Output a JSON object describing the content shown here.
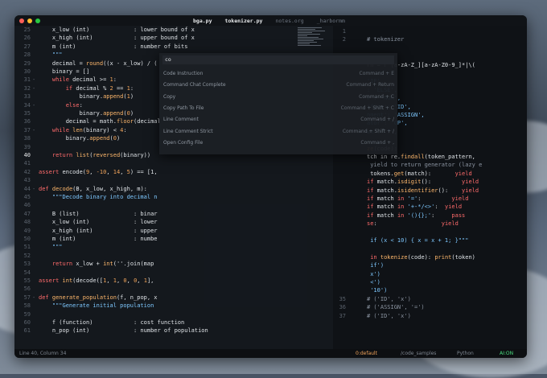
{
  "window": {
    "tabs": [
      {
        "label": "bga.py",
        "active": true
      },
      {
        "label": "tokenizer.py",
        "active": true
      },
      {
        "label": "notes.org",
        "active": false
      },
      {
        "label": "_harbormm",
        "active": false
      }
    ]
  },
  "editor": {
    "lines": [
      {
        "n": "25",
        "code": [
          [
            "p",
            "    x_low (int)"
          ],
          [
            "p",
            "             : lower bound of x"
          ]
        ]
      },
      {
        "n": "26",
        "code": [
          [
            "p",
            "    x_high (int)"
          ],
          [
            "p",
            "            : upper bound of x"
          ]
        ]
      },
      {
        "n": "27",
        "code": [
          [
            "p",
            "    m (int)"
          ],
          [
            "p",
            "                 : number of bits"
          ]
        ]
      },
      {
        "n": "28",
        "code": [
          [
            "s",
            "    \"\"\""
          ]
        ]
      },
      {
        "n": "29",
        "code": [
          [
            "p",
            "    decimal = "
          ],
          [
            "f",
            "round"
          ],
          [
            "p",
            "((x - x_low) / ("
          ]
        ]
      },
      {
        "n": "30",
        "code": [
          [
            "p",
            "    binary = []"
          ]
        ]
      },
      {
        "n": "31",
        "fold": "-",
        "code": [
          [
            "k",
            "    while"
          ],
          [
            "p",
            " decimal >= "
          ],
          [
            "n",
            "1"
          ],
          [
            "p",
            ":"
          ]
        ]
      },
      {
        "n": "32",
        "fold": "-",
        "code": [
          [
            "k",
            "        if"
          ],
          [
            "p",
            " decimal % "
          ],
          [
            "n",
            "2"
          ],
          [
            "p",
            " == "
          ],
          [
            "n",
            "1"
          ],
          [
            "p",
            ":"
          ]
        ]
      },
      {
        "n": "33",
        "code": [
          [
            "p",
            "            binary."
          ],
          [
            "f",
            "append"
          ],
          [
            "p",
            "("
          ],
          [
            "n",
            "1"
          ],
          [
            "p",
            ")"
          ]
        ]
      },
      {
        "n": "34",
        "fold": "-",
        "code": [
          [
            "k",
            "        else"
          ],
          [
            "p",
            ":"
          ]
        ]
      },
      {
        "n": "35",
        "code": [
          [
            "p",
            "            binary."
          ],
          [
            "f",
            "append"
          ],
          [
            "p",
            "("
          ],
          [
            "n",
            "0"
          ],
          [
            "p",
            ")"
          ]
        ]
      },
      {
        "n": "36",
        "code": [
          [
            "p",
            "        decimal = math."
          ],
          [
            "f",
            "floor"
          ],
          [
            "p",
            "(decimal"
          ]
        ]
      },
      {
        "n": "37",
        "fold": "-",
        "code": [
          [
            "k",
            "    while"
          ],
          [
            "f",
            " len"
          ],
          [
            "p",
            "(binary) < "
          ],
          [
            "n",
            "4"
          ],
          [
            "p",
            ":"
          ]
        ]
      },
      {
        "n": "38",
        "code": [
          [
            "p",
            "        binary."
          ],
          [
            "f",
            "append"
          ],
          [
            "p",
            "("
          ],
          [
            "n",
            "0"
          ],
          [
            "p",
            ")"
          ]
        ]
      },
      {
        "n": "39",
        "code": [
          [
            "p",
            ""
          ]
        ]
      },
      {
        "n": "40",
        "cur": true,
        "code": [
          [
            "k",
            "    return"
          ],
          [
            "f",
            " list"
          ],
          [
            "p",
            "("
          ],
          [
            "f",
            "reversed"
          ],
          [
            "p",
            "(binary))"
          ]
        ]
      },
      {
        "n": "41",
        "code": [
          [
            "p",
            ""
          ]
        ]
      },
      {
        "n": "42",
        "code": [
          [
            "k",
            "assert"
          ],
          [
            "p",
            " encode("
          ],
          [
            "n",
            "9"
          ],
          [
            "p",
            ", "
          ],
          [
            "n",
            "-10"
          ],
          [
            "p",
            ", "
          ],
          [
            "n",
            "14"
          ],
          [
            "p",
            ", "
          ],
          [
            "n",
            "5"
          ],
          [
            "p",
            ") == [1,"
          ]
        ]
      },
      {
        "n": "43",
        "code": [
          [
            "p",
            ""
          ]
        ]
      },
      {
        "n": "44",
        "fold": "-",
        "code": [
          [
            "k",
            "def"
          ],
          [
            "f",
            " decode"
          ],
          [
            "p",
            "(B, x_low, x_high, m):"
          ]
        ]
      },
      {
        "n": "45",
        "code": [
          [
            "s",
            "    \"\"\"Decode binary into decimal n"
          ]
        ]
      },
      {
        "n": "46",
        "code": [
          [
            "p",
            ""
          ]
        ]
      },
      {
        "n": "47",
        "code": [
          [
            "p",
            "    B (list)"
          ],
          [
            "p",
            "                : binar"
          ]
        ]
      },
      {
        "n": "48",
        "code": [
          [
            "p",
            "    x_low (int)"
          ],
          [
            "p",
            "             : lower"
          ]
        ]
      },
      {
        "n": "49",
        "code": [
          [
            "p",
            "    x_high (int)"
          ],
          [
            "p",
            "            : upper"
          ]
        ]
      },
      {
        "n": "50",
        "code": [
          [
            "p",
            "    m (int)"
          ],
          [
            "p",
            "                 : numbe"
          ]
        ]
      },
      {
        "n": "51",
        "code": [
          [
            "s",
            "    \"\"\""
          ]
        ]
      },
      {
        "n": "52",
        "code": [
          [
            "p",
            ""
          ]
        ]
      },
      {
        "n": "53",
        "code": [
          [
            "k",
            "    return"
          ],
          [
            "p",
            " x_low + "
          ],
          [
            "f",
            "int"
          ],
          [
            "p",
            "(''.join(map"
          ]
        ]
      },
      {
        "n": "54",
        "code": [
          [
            "p",
            ""
          ]
        ]
      },
      {
        "n": "55",
        "code": [
          [
            "k",
            "assert"
          ],
          [
            "f",
            " int"
          ],
          [
            "p",
            "(decode(["
          ],
          [
            "n",
            "1"
          ],
          [
            "p",
            ", "
          ],
          [
            "n",
            "1"
          ],
          [
            "p",
            ", "
          ],
          [
            "n",
            "0"
          ],
          [
            "p",
            ", "
          ],
          [
            "n",
            "0"
          ],
          [
            "p",
            ", "
          ],
          [
            "n",
            "1"
          ],
          [
            "p",
            "],"
          ]
        ]
      },
      {
        "n": "56",
        "code": [
          [
            "p",
            ""
          ]
        ]
      },
      {
        "n": "57",
        "fold": "-",
        "code": [
          [
            "k",
            "def"
          ],
          [
            "f",
            " generate_population"
          ],
          [
            "p",
            "(f, n_pop, x"
          ]
        ]
      },
      {
        "n": "58",
        "code": [
          [
            "s",
            "    \"\"\"Generate initial population"
          ]
        ]
      },
      {
        "n": "59",
        "code": [
          [
            "p",
            ""
          ]
        ]
      },
      {
        "n": "60",
        "code": [
          [
            "p",
            "    f (function)"
          ],
          [
            "p",
            "            : cost function"
          ]
        ]
      },
      {
        "n": "61",
        "code": [
          [
            "p",
            "    n_pop (int)"
          ],
          [
            "p",
            "             : number of population"
          ]
        ]
      }
    ]
  },
  "right_pane": {
    "lines": [
      {
        "n": "1",
        "code": [
          [
            "p",
            ""
          ]
        ]
      },
      {
        "n": "2",
        "code": [
          [
            "c",
            "# tokenizer"
          ]
        ]
      },
      {
        "n": "",
        "code": [
          [
            "p",
            ""
          ]
        ]
      },
      {
        "n": "",
        "code": [
          [
            "p",
            ""
          ]
        ]
      },
      {
        "n": "",
        "code": [
          [
            "p",
            "rn = r'[a-zA-Z_][a-zA-Z0-9_]*|\\("
          ]
        ]
      },
      {
        "n": "",
        "code": [
          [
            "p",
            ""
          ]
        ]
      },
      {
        "n": "",
        "code": [
          [
            "s",
            "'IF',"
          ]
        ]
      },
      {
        "n": "",
        "code": [
          [
            "s",
            ": 'ELSE',"
          ]
        ]
      },
      {
        "n": "",
        "code": [
          [
            "s",
            "r': 'NUM',"
          ]
        ]
      },
      {
        "n": "",
        "code": [
          [
            "s",
            "ifier': 'ID',"
          ]
        ]
      },
      {
        "n": "",
        "code": [
          [
            "s",
            "nment': 'ASSIGN',"
          ]
        ]
      },
      {
        "n": "",
        "code": [
          [
            "s",
            "ator': 'OP',"
          ]
        ]
      },
      {
        "n": "",
        "code": [
          [
            "s",
            "wn': '?',"
          ]
        ]
      },
      {
        "n": "",
        "code": [
          [
            "p",
            ""
          ]
        ]
      },
      {
        "n": "",
        "code": [
          [
            "f",
            "ze"
          ],
          [
            "p",
            "(code):"
          ]
        ]
      },
      {
        "n": "",
        "code": [
          [
            "p",
            "tch in re."
          ],
          [
            "f",
            "findall"
          ],
          [
            "p",
            "(token_pattern,"
          ]
        ]
      },
      {
        "n": "",
        "code": [
          [
            "c",
            " yield to return generator (lazy e"
          ]
        ]
      },
      {
        "n": "",
        "code": [
          [
            "p",
            " tokens."
          ],
          [
            "f",
            "get"
          ],
          [
            "p",
            "(match):"
          ],
          [
            "k",
            "       yield"
          ]
        ]
      },
      {
        "n": "",
        "code": [
          [
            "k",
            "if"
          ],
          [
            "p",
            " match."
          ],
          [
            "f",
            "isdigit"
          ],
          [
            "p",
            "():"
          ],
          [
            "k",
            "         yield"
          ]
        ]
      },
      {
        "n": "",
        "code": [
          [
            "k",
            "if"
          ],
          [
            "p",
            " match."
          ],
          [
            "f",
            "isidentifier"
          ],
          [
            "p",
            "():"
          ],
          [
            "k",
            "    yield"
          ]
        ]
      },
      {
        "n": "",
        "code": [
          [
            "k",
            "if"
          ],
          [
            "p",
            " match "
          ],
          [
            "k",
            "in"
          ],
          [
            "s",
            " '='"
          ],
          [
            "p",
            ":"
          ],
          [
            "k",
            "         yield"
          ]
        ]
      },
      {
        "n": "",
        "code": [
          [
            "k",
            "if"
          ],
          [
            "p",
            " match "
          ],
          [
            "k",
            "in"
          ],
          [
            "s",
            " '+-*/<>'"
          ],
          [
            "p",
            ":"
          ],
          [
            "k",
            "  yield"
          ]
        ]
      },
      {
        "n": "",
        "code": [
          [
            "k",
            "if"
          ],
          [
            "p",
            " match "
          ],
          [
            "k",
            "in"
          ],
          [
            "s",
            " '(){};'"
          ],
          [
            "p",
            ":"
          ],
          [
            "k",
            "     pass"
          ]
        ]
      },
      {
        "n": "",
        "code": [
          [
            "k",
            "se"
          ],
          [
            "p",
            ":"
          ],
          [
            "k",
            "                   yield"
          ]
        ]
      },
      {
        "n": "",
        "code": [
          [
            "p",
            ""
          ]
        ]
      },
      {
        "n": "",
        "code": [
          [
            "s",
            " if (x < 10) { x = x + 1; }\"\"\""
          ]
        ]
      },
      {
        "n": "",
        "code": [
          [
            "p",
            ""
          ]
        ]
      },
      {
        "n": "",
        "code": [
          [
            "k",
            " in"
          ],
          [
            "f",
            " tokenize"
          ],
          [
            "p",
            "(code): "
          ],
          [
            "f",
            "print"
          ],
          [
            "p",
            "(token)"
          ]
        ]
      },
      {
        "n": "",
        "code": [
          [
            "s",
            " if')"
          ]
        ]
      },
      {
        "n": "",
        "code": [
          [
            "s",
            " x')"
          ]
        ]
      },
      {
        "n": "",
        "code": [
          [
            "s",
            " <')"
          ]
        ]
      },
      {
        "n": "",
        "code": [
          [
            "s",
            " '10')"
          ]
        ]
      },
      {
        "n": "35",
        "code": [
          [
            "c",
            "# ('ID', 'x')"
          ]
        ]
      },
      {
        "n": "36",
        "code": [
          [
            "c",
            "# ('ASSIGN', '=')"
          ]
        ]
      },
      {
        "n": "37",
        "code": [
          [
            "c",
            "# ('ID', 'x')"
          ]
        ]
      }
    ]
  },
  "palette": {
    "query": "co",
    "items": [
      {
        "label": "Code Instruction",
        "shortcut": "Command + E"
      },
      {
        "label": "Command Chat Complete",
        "shortcut": "Command + Return"
      },
      {
        "label": "Copy",
        "shortcut": "Command + C"
      },
      {
        "label": "Copy Path To File",
        "shortcut": "Command + Shift + C"
      },
      {
        "label": "Line Comment",
        "shortcut": "Command + /"
      },
      {
        "label": "Line Comment Strict",
        "shortcut": "Command + Shift + /"
      },
      {
        "label": "Open Config File",
        "shortcut": "Command + ,"
      }
    ]
  },
  "statusbar": {
    "position": "Line 40, Column 34",
    "branch": "0:default",
    "path": "/code_samples",
    "language": "Python",
    "ai": "AI:ON"
  },
  "colors": {
    "accent": "#f0a35a",
    "ai_on": "#4ade80",
    "keyword": "#ff6b6b",
    "string": "#7ec8ff"
  }
}
